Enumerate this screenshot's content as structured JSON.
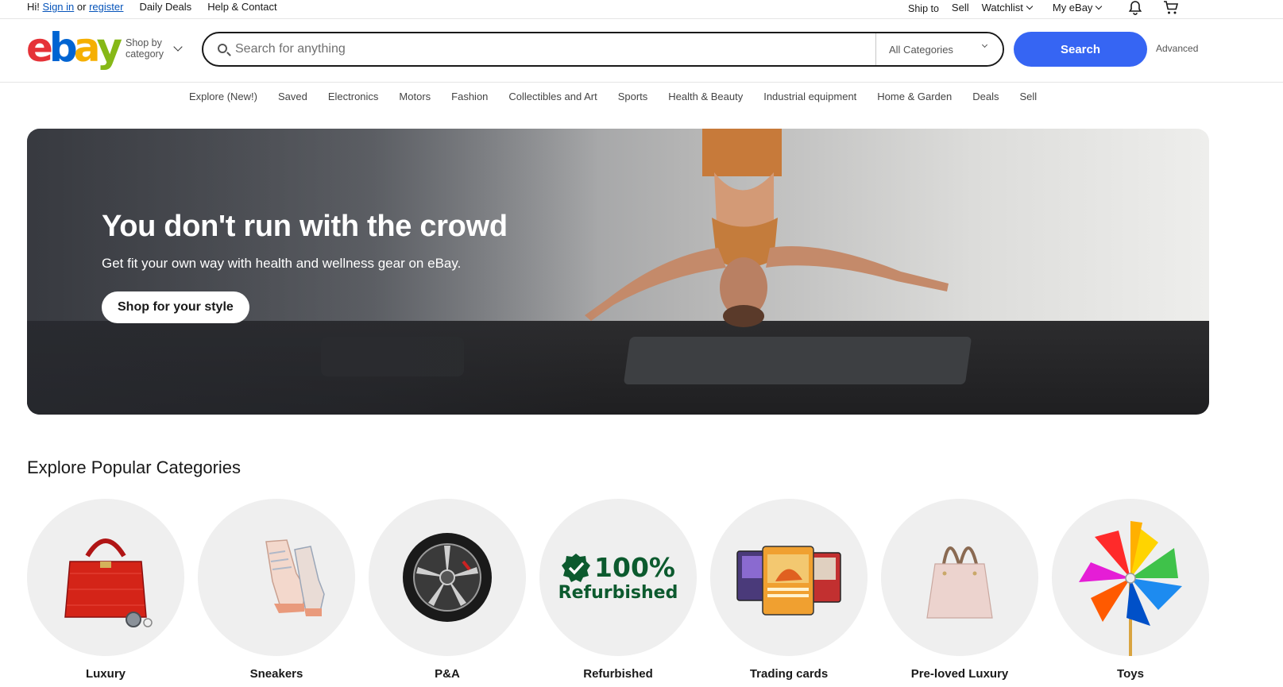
{
  "topbar": {
    "greeting": "Hi!",
    "sign_in": "Sign in",
    "or": "or",
    "register": "register",
    "daily_deals": "Daily Deals",
    "help_contact": "Help & Contact",
    "ship_to": "Ship to",
    "sell": "Sell",
    "watchlist": "Watchlist",
    "my_ebay": "My eBay",
    "notification_icon": "bell-icon",
    "cart_icon": "cart-icon"
  },
  "header": {
    "logo_letters": [
      "e",
      "b",
      "a",
      "y"
    ],
    "logo_colors": [
      "#e53238",
      "#0064d2",
      "#f5af02",
      "#86b817"
    ],
    "shop_by_line1": "Shop by",
    "shop_by_line2": "category",
    "search_placeholder": "Search for anything",
    "category_select": "All Categories",
    "search_button": "Search",
    "advanced": "Advanced",
    "accent_color": "#3665f3"
  },
  "nav": {
    "items": [
      "Explore (New!)",
      "Saved",
      "Electronics",
      "Motors",
      "Fashion",
      "Collectibles and Art",
      "Sports",
      "Health & Beauty",
      "Industrial equipment",
      "Home & Garden",
      "Deals",
      "Sell"
    ]
  },
  "hero": {
    "title": "You don't run with the crowd",
    "subtitle": "Get fit your own way with health and wellness gear on eBay.",
    "cta": "Shop for your style"
  },
  "categories": {
    "title": "Explore Popular Categories",
    "items": [
      {
        "label": "Luxury",
        "icon": "handbag-icon"
      },
      {
        "label": "Sneakers",
        "icon": "sneaker-icon"
      },
      {
        "label": "P&A",
        "icon": "wheel-icon"
      },
      {
        "label": "Refurbished",
        "icon": "refurbished-badge-icon",
        "badge_line1": "100%",
        "badge_line2": "Refurbished"
      },
      {
        "label": "Trading cards",
        "icon": "trading-cards-icon"
      },
      {
        "label": "Pre-loved Luxury",
        "icon": "tote-bag-icon"
      },
      {
        "label": "Toys",
        "icon": "pinwheel-icon"
      }
    ]
  }
}
